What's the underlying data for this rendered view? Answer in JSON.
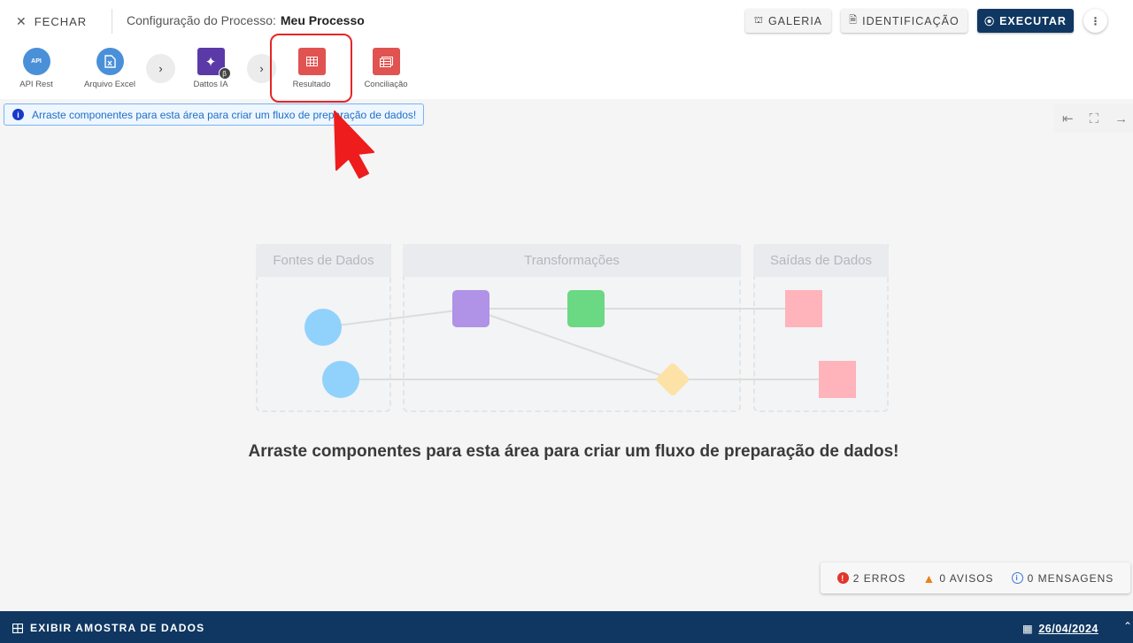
{
  "header": {
    "close_label": "FECHAR",
    "title_label": "Configuração do Processo:",
    "process_name": "Meu Processo",
    "gallery_label": "GALERIA",
    "identification_label": "IDENTIFICAÇÃO",
    "execute_label": "EXECUTAR",
    "more_icon": "⋮"
  },
  "components": [
    {
      "label": "API Rest",
      "icon": "API",
      "icon_name": "api-icon",
      "color": "#4a90d9"
    },
    {
      "label": "Arquivo Excel",
      "icon": "excel",
      "icon_name": "excel-file-icon",
      "color": "#4a90d9"
    },
    {
      "label": "Dattos IA",
      "icon": "ai",
      "icon_name": "sparkle-icon",
      "color": "#5b3aa8",
      "badge": "β"
    },
    {
      "label": "Resultado",
      "icon": "table",
      "icon_name": "table-icon",
      "color": "#e05350"
    },
    {
      "label": "Conciliação",
      "icon": "reconcile",
      "icon_name": "reconciliation-icon",
      "color": "#e05350"
    }
  ],
  "info_banner": {
    "text": "Arraste componentes para esta área para criar um fluxo de preparação de dados!",
    "icon": "i"
  },
  "illustration": {
    "zones": {
      "sources": "Fontes de Dados",
      "transforms": "Transformações",
      "outputs": "Saídas de Dados"
    },
    "colors": {
      "source": "#90d2fb",
      "purple": "#b092e6",
      "green": "#6bd884",
      "diamond": "#fde2a8",
      "output": "#ffb3ba"
    }
  },
  "main_message": "Arraste componentes para esta área para criar um fluxo de preparação de dados!",
  "status": {
    "errors": "2 ERROS",
    "warnings": "0 AVISOS",
    "messages": "0 MENSAGENS"
  },
  "footer": {
    "sample_label": "EXIBIR AMOSTRA DE DADOS",
    "date": "26/04/2024"
  },
  "colors": {
    "accent_dark": "#0f3761",
    "highlight": "#e52626",
    "info": "#1e6fc9"
  }
}
